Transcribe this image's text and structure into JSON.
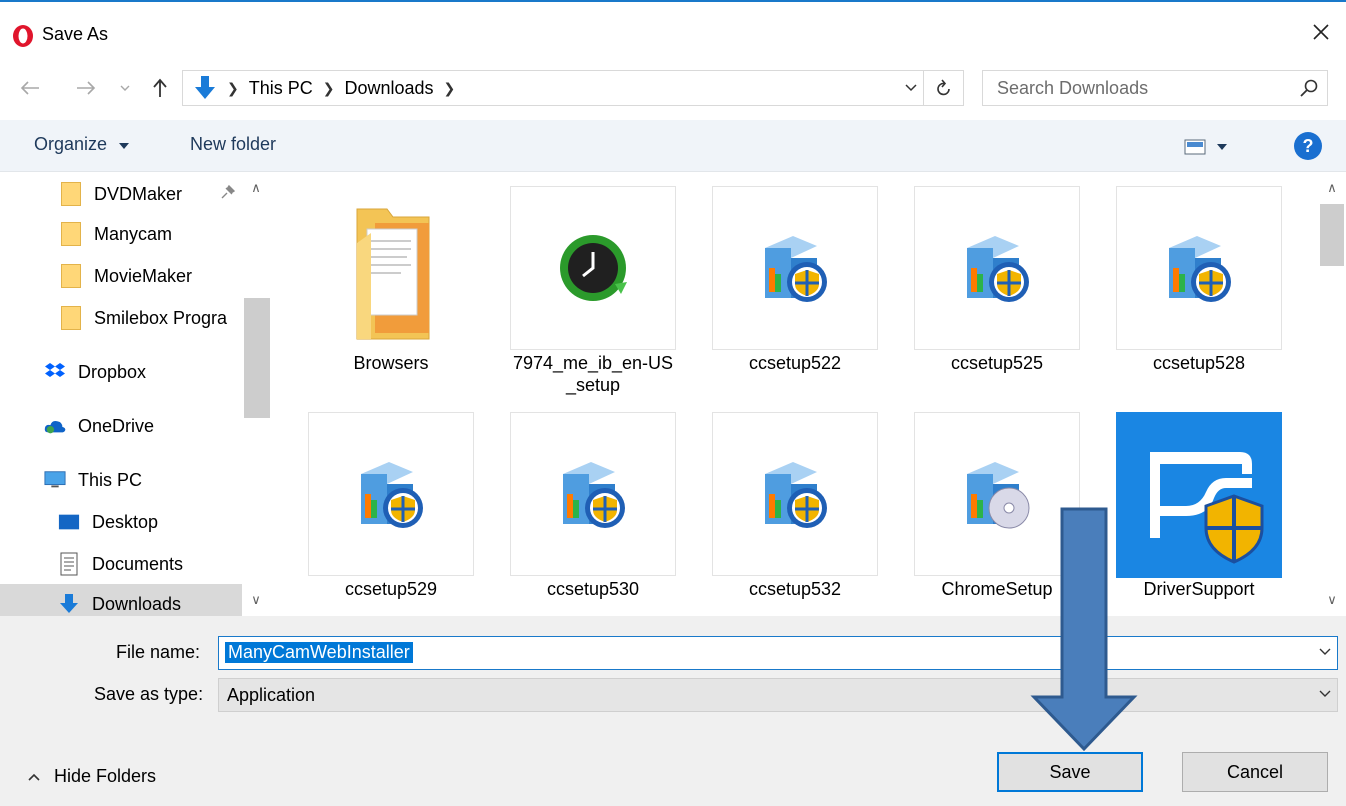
{
  "window": {
    "title": "Save As"
  },
  "address": {
    "crumbs": [
      "This PC",
      "Downloads"
    ],
    "search_placeholder": "Search Downloads"
  },
  "toolbar": {
    "organize_label": "Organize",
    "new_folder_label": "New folder",
    "help_label": "?"
  },
  "nav": {
    "items": [
      {
        "label": "DVDMaker",
        "icon": "folder-icon",
        "pinned": true
      },
      {
        "label": "Manycam",
        "icon": "folder-icon"
      },
      {
        "label": "MovieMaker",
        "icon": "folder-icon"
      },
      {
        "label": "Smilebox Progra",
        "icon": "folder-icon"
      },
      {
        "label": "Dropbox",
        "icon": "dropbox-icon"
      },
      {
        "label": "OneDrive",
        "icon": "onedrive-icon"
      },
      {
        "label": "This PC",
        "icon": "computer-icon"
      },
      {
        "label": "Desktop",
        "icon": "desktop-icon"
      },
      {
        "label": "Documents",
        "icon": "documents-icon"
      },
      {
        "label": "Downloads",
        "icon": "downloads-icon",
        "selected": true
      }
    ]
  },
  "files": [
    {
      "name": "Browsers",
      "icon": "folder-icon"
    },
    {
      "name": "7974_me_ib_en-US_setup",
      "icon": "clock-refresh-icon"
    },
    {
      "name": "ccsetup522",
      "icon": "installer-icon"
    },
    {
      "name": "ccsetup525",
      "icon": "installer-icon"
    },
    {
      "name": "ccsetup528",
      "icon": "installer-icon"
    },
    {
      "name": "ccsetup529",
      "icon": "installer-icon"
    },
    {
      "name": "ccsetup530",
      "icon": "installer-icon"
    },
    {
      "name": "ccsetup532",
      "icon": "installer-icon"
    },
    {
      "name": "ChromeSetup",
      "icon": "installer-disc-icon"
    },
    {
      "name": "DriverSupport",
      "icon": "driversupport-icon"
    }
  ],
  "form": {
    "file_name_label": "File name:",
    "file_name_value": "ManyCamWebInstaller",
    "save_type_label": "Save as type:",
    "save_type_value": "Application"
  },
  "footer": {
    "hide_folders_label": "Hide Folders",
    "save_label": "Save",
    "cancel_label": "Cancel"
  },
  "colors": {
    "accent": "#0078d7",
    "toolbar_bg": "#f0f4f9",
    "bottom_bg": "#f0f0f0",
    "overlay_arrow": "#4a7ebb"
  }
}
